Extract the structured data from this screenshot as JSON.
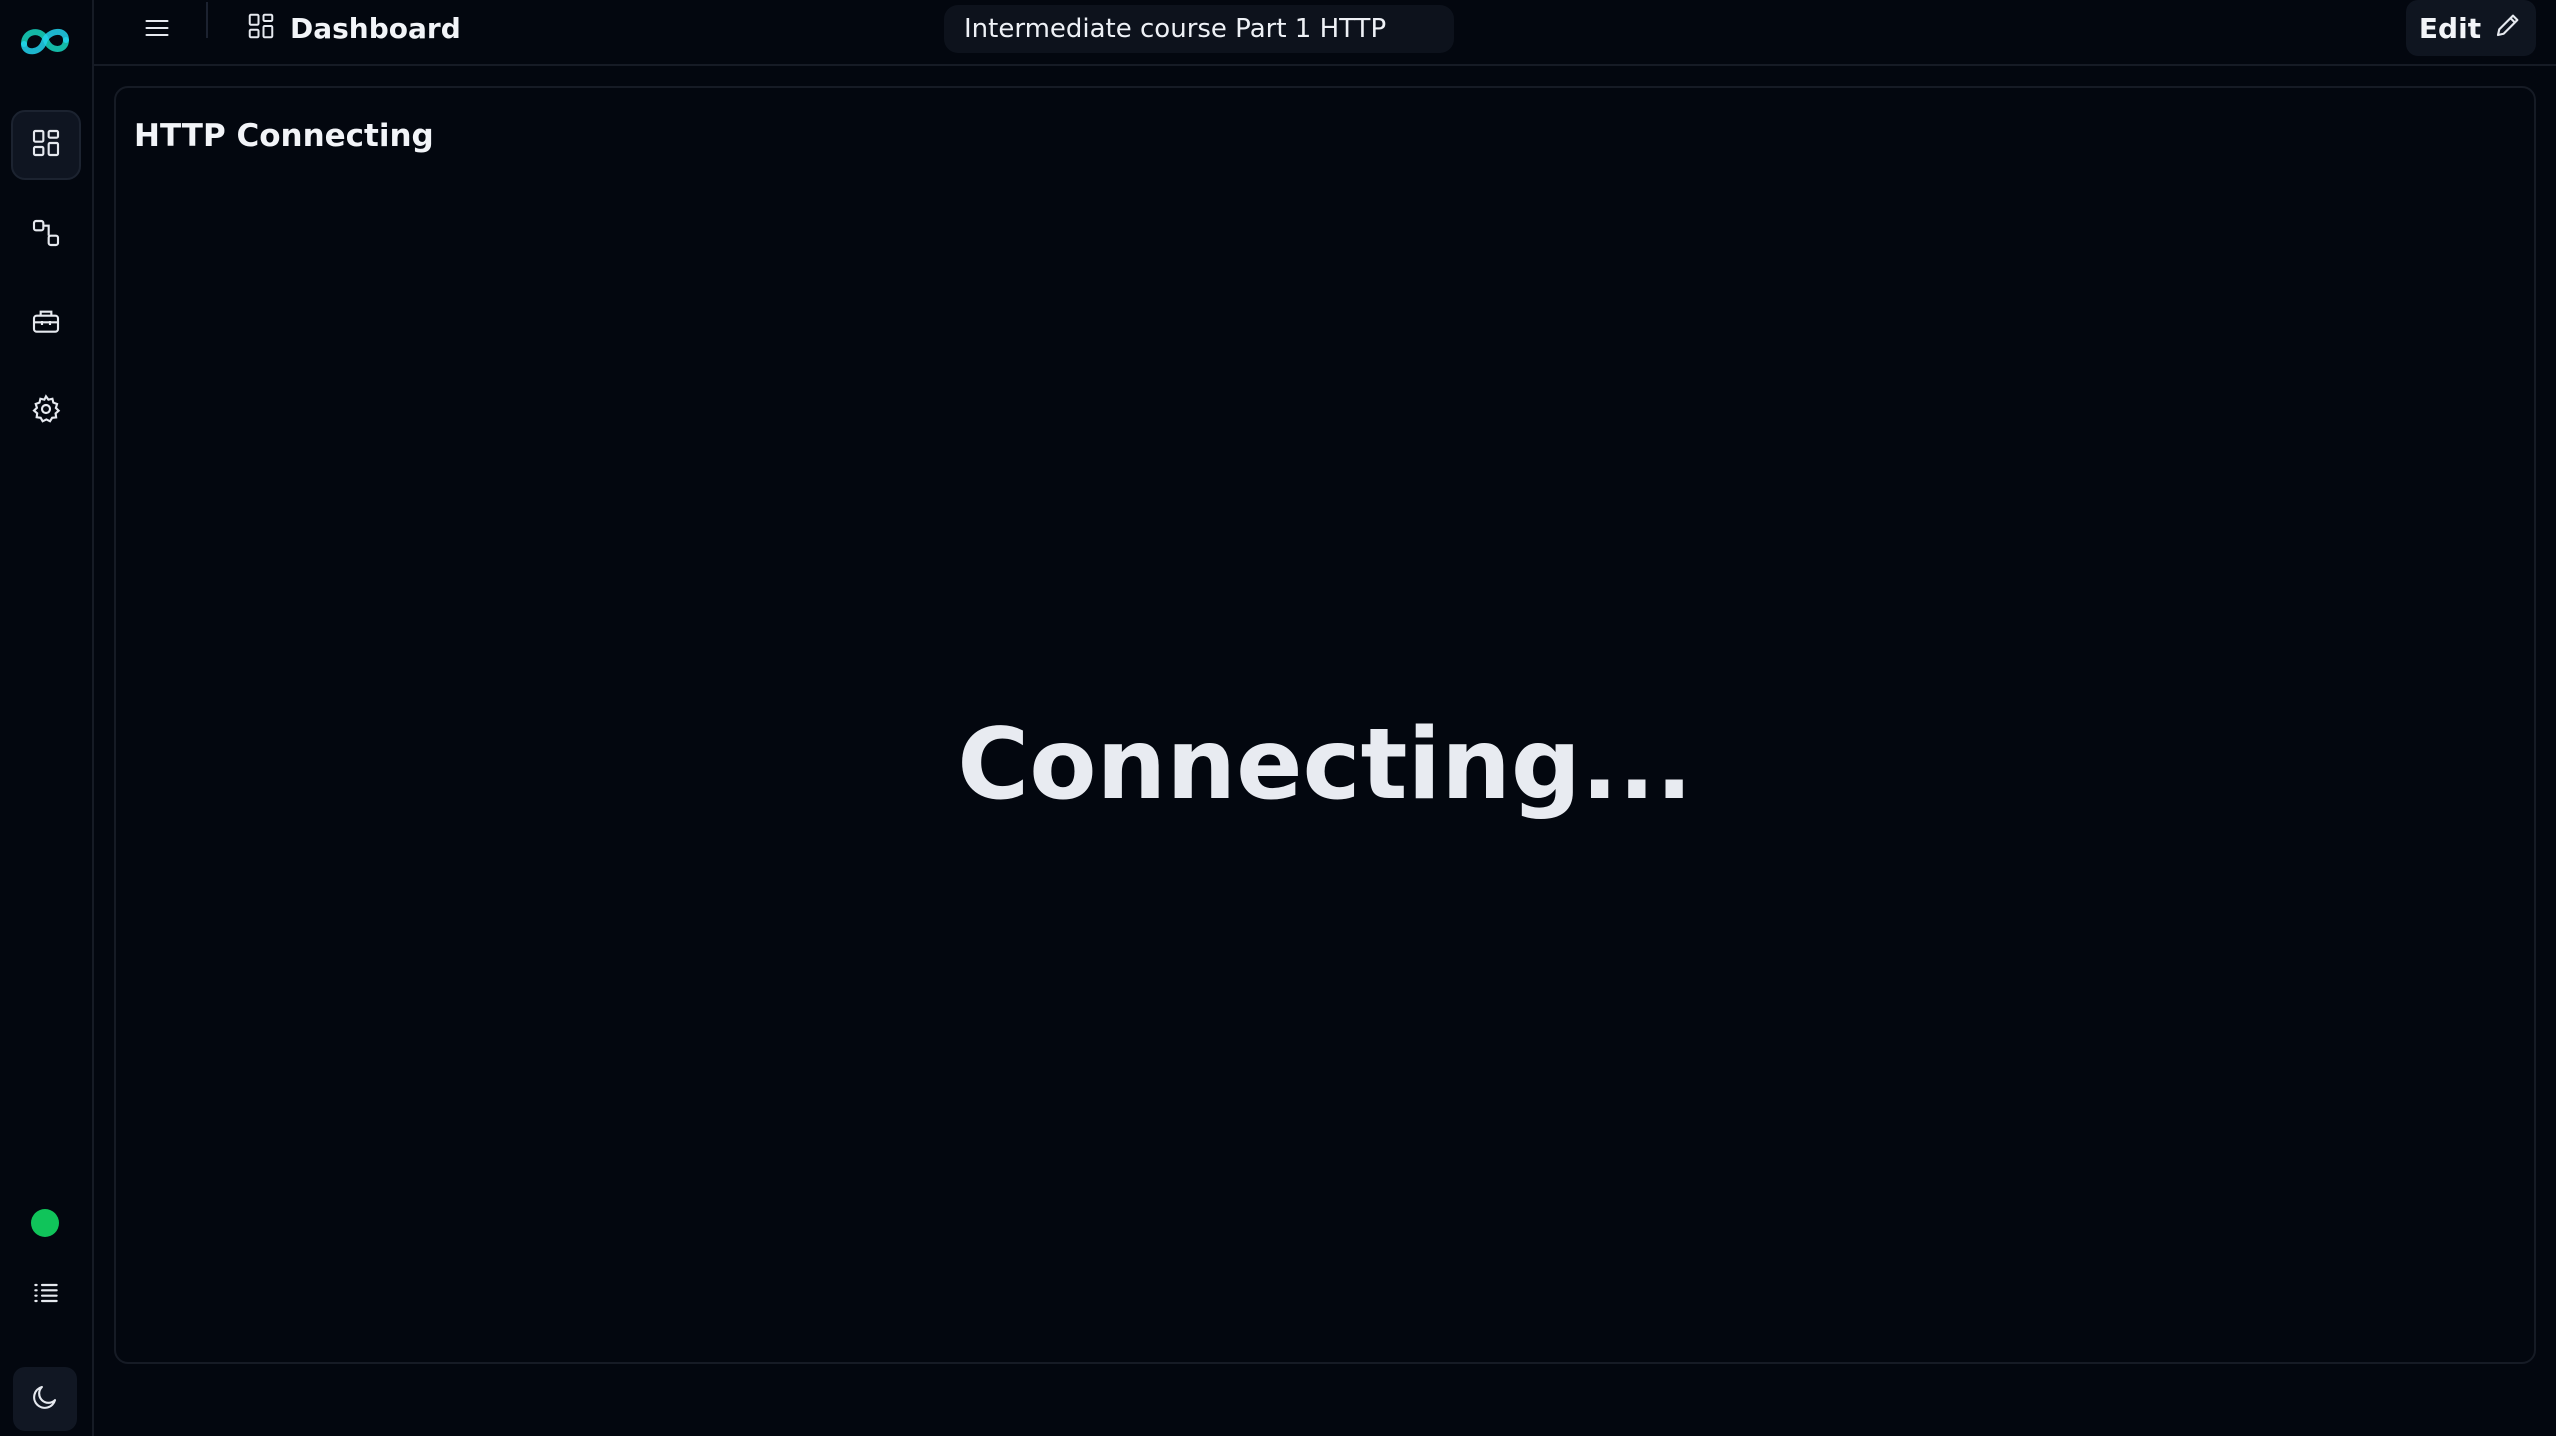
{
  "sidebar": {
    "logo": "app-logo",
    "items": [
      {
        "icon": "dashboard-grid-icon",
        "active": true
      },
      {
        "icon": "flow-nodes-icon",
        "active": false
      },
      {
        "icon": "toolbox-icon",
        "active": false
      },
      {
        "icon": "gear-icon",
        "active": false
      }
    ],
    "status_color": "#10c45a",
    "bottom_items": [
      {
        "icon": "list-icon"
      },
      {
        "icon": "moon-icon"
      }
    ]
  },
  "header": {
    "menu_icon": "hamburger-menu-icon",
    "breadcrumb": {
      "icon": "dashboard-grid-icon",
      "label": "Dashboard"
    },
    "dashboard_title": "Intermediate course Part 1 HTTP",
    "edit_label": "Edit",
    "edit_icon": "pencil-icon"
  },
  "main": {
    "panel_title": "HTTP Connecting",
    "status_message": "Connecting..."
  },
  "colors": {
    "background": "#03070f",
    "accent": "#10c45a",
    "text": "#e8ebf1",
    "border": "#161b25"
  }
}
